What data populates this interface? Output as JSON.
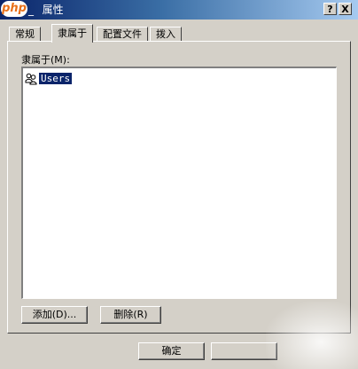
{
  "window": {
    "title_prefix": "_",
    "title_obscured": "    ",
    "title_text": "属性",
    "logo_text": "php",
    "help_button": "?",
    "close_button": "X"
  },
  "tabs": [
    {
      "label": "常规",
      "active": false
    },
    {
      "label": "隶属于",
      "active": true
    },
    {
      "label": "配置文件",
      "active": false
    },
    {
      "label": "拨入",
      "active": false
    }
  ],
  "membership": {
    "label": "隶属于(M):",
    "items": [
      {
        "label": "Users",
        "icon": "group-icon"
      }
    ]
  },
  "buttons": {
    "add": "添加(D)...",
    "remove": "删除(R)",
    "ok": "确定",
    "cancel": ""
  }
}
